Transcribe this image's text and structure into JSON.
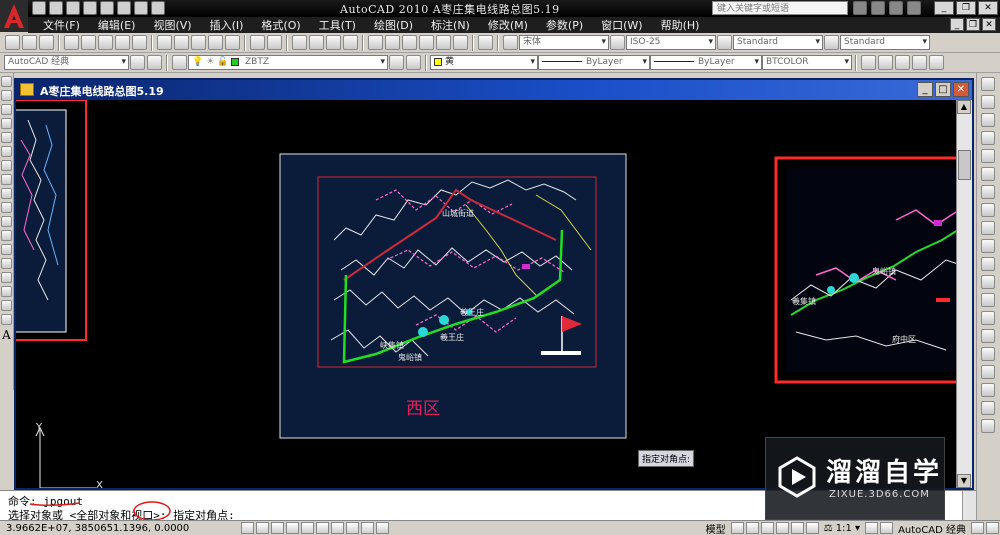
{
  "app": {
    "title": "AutoCAD 2010   A枣庄集电线路总图5.19",
    "search_placeholder": "键入关键字或短语"
  },
  "menu": {
    "items": [
      "文件(F)",
      "编辑(E)",
      "视图(V)",
      "插入(I)",
      "格式(O)",
      "工具(T)",
      "绘图(D)",
      "标注(N)",
      "修改(M)",
      "参数(P)",
      "窗口(W)",
      "帮助(H)"
    ]
  },
  "toolbar": {
    "text_style": "宋体",
    "dim_style": "ISO-25",
    "table_style": "Standard",
    "multileader_style": "Standard",
    "workspace": "AutoCAD 经典",
    "layer": "ZBTZ",
    "color": "黄",
    "linetype": "ByLayer",
    "lineweight": "ByLayer",
    "plotstyle": "BTCOLOR"
  },
  "drawing_window": {
    "title": "A枣庄集电线路总图5.19"
  },
  "drawing": {
    "region_label": "西区",
    "map_labels": {
      "shanchenghu": "山城街道",
      "xiwangzhuang": "羲王庄",
      "xiwangzhuang2": "羲王庄",
      "guiyuzhen": "鬼峪镇",
      "xiajizhen": "峡集镇",
      "right_guiyuzhen": "鬼峪镇",
      "right_xizhen": "羲集镇",
      "right_fuzhongqu": "府中区"
    },
    "ucs_y": "Y",
    "ucs_x": "X",
    "tooltip": "指定对角点:"
  },
  "command": {
    "line1": "命令: jpgout",
    "line2": "选择对象或 <全部对象和视口>: 指定对角点:"
  },
  "status": {
    "coords": "3.9662E+07, 3850651.1396, 0.0000",
    "model": "模型",
    "scale": "1:1",
    "workspace": "AutoCAD 经典"
  },
  "watermark": {
    "brand": "溜溜自学",
    "url": "ZIXUE.3D66.COM"
  },
  "colors": {
    "titlebar": "#000000",
    "drawing_bg": "#000000",
    "map_bg": "#0b1c3a",
    "red_frame": "#ff2a2a",
    "green_line": "#22dd22",
    "region_label": "#e0205a",
    "window_title": "#0a246a"
  }
}
